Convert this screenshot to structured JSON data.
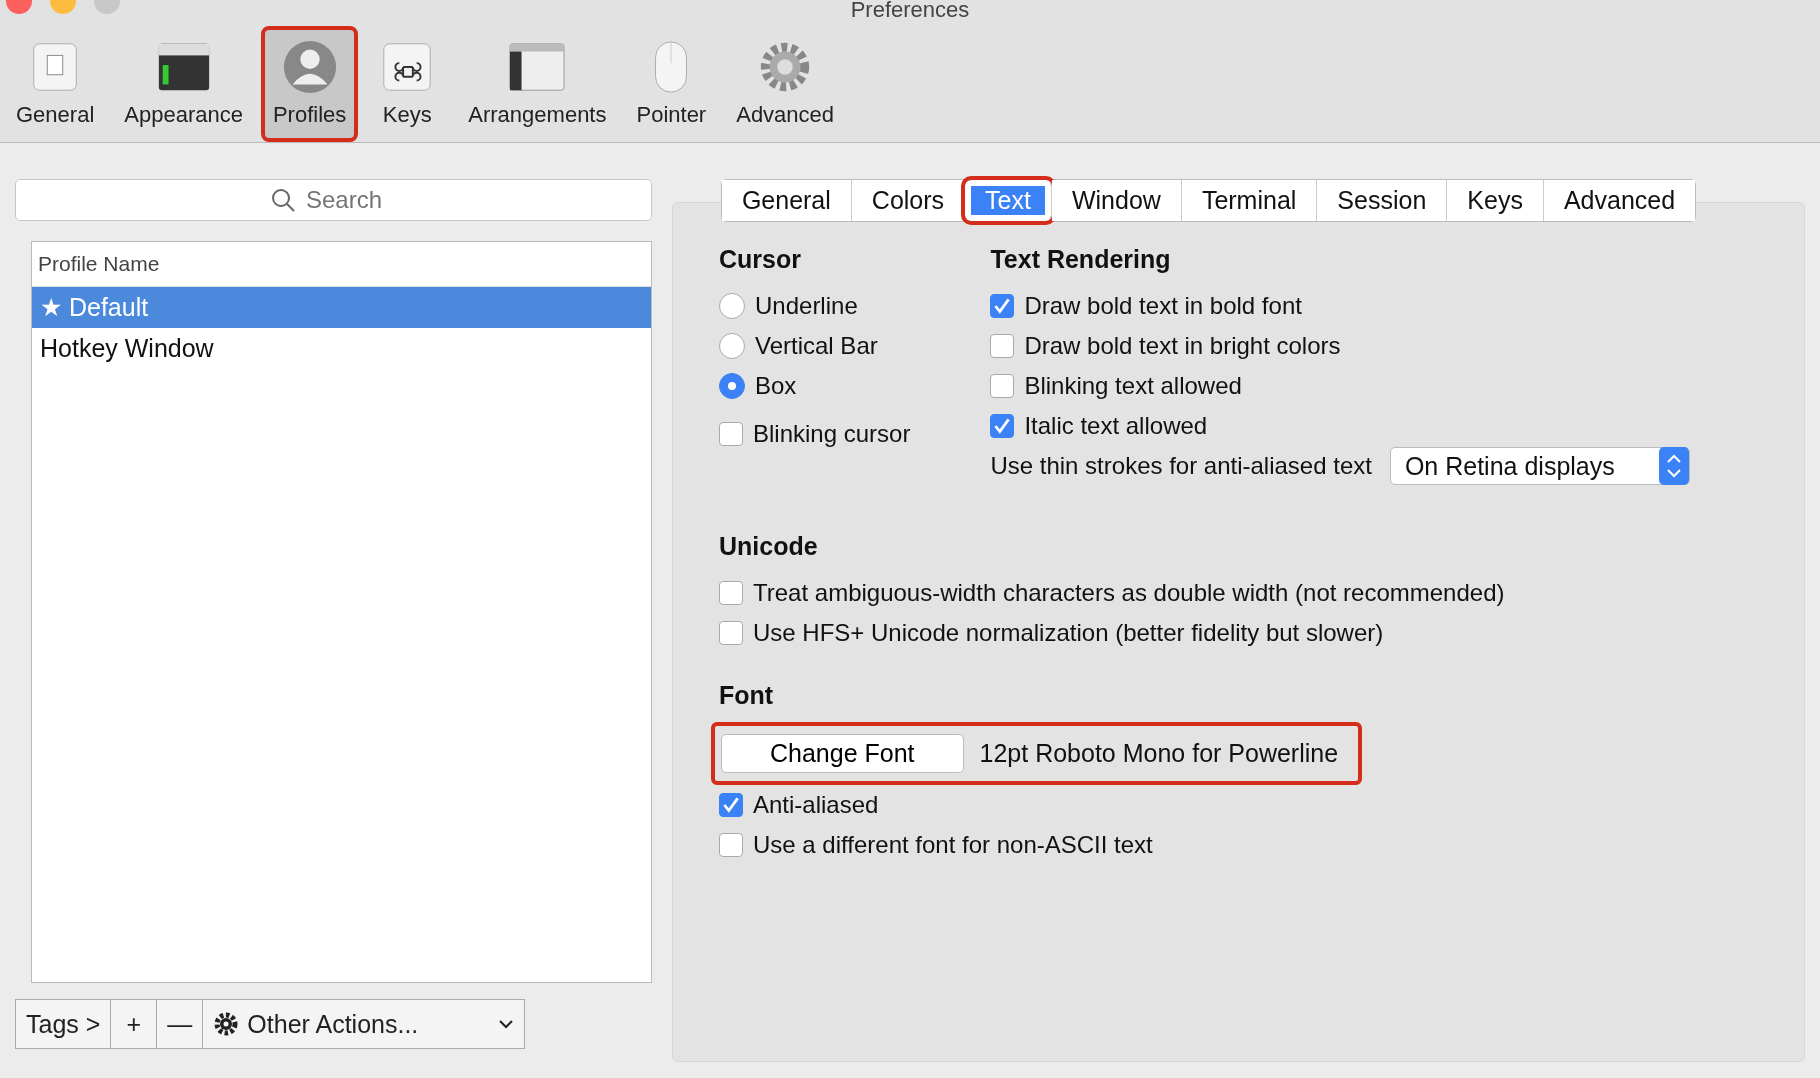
{
  "window": {
    "title": "Preferences"
  },
  "toolbar": [
    {
      "kind": "general",
      "label": "General",
      "selected": false,
      "highlighted": false
    },
    {
      "kind": "appearance",
      "label": "Appearance",
      "selected": false,
      "highlighted": false
    },
    {
      "kind": "profiles",
      "label": "Profiles",
      "selected": true,
      "highlighted": true
    },
    {
      "kind": "keys",
      "label": "Keys",
      "selected": false,
      "highlighted": false
    },
    {
      "kind": "arrangements",
      "label": "Arrangements",
      "selected": false,
      "highlighted": false
    },
    {
      "kind": "pointer",
      "label": "Pointer",
      "selected": false,
      "highlighted": false
    },
    {
      "kind": "advanced",
      "label": "Advanced",
      "selected": false,
      "highlighted": false
    }
  ],
  "search": {
    "placeholder": "Search"
  },
  "profiles": {
    "column": "Profile Name",
    "rows": [
      {
        "name": "★ Default",
        "selected": true
      },
      {
        "name": "Hotkey Window",
        "selected": false
      }
    ]
  },
  "bottom_bar": {
    "tags": "Tags >",
    "add": "+",
    "remove": "—",
    "actions": "Other Actions..."
  },
  "tabs": [
    {
      "label": "General",
      "selected": false,
      "highlighted": false
    },
    {
      "label": "Colors",
      "selected": false,
      "highlighted": false
    },
    {
      "label": "Text",
      "selected": true,
      "highlighted": true
    },
    {
      "label": "Window",
      "selected": false,
      "highlighted": false
    },
    {
      "label": "Terminal",
      "selected": false,
      "highlighted": false
    },
    {
      "label": "Session",
      "selected": false,
      "highlighted": false
    },
    {
      "label": "Keys",
      "selected": false,
      "highlighted": false
    },
    {
      "label": "Advanced",
      "selected": false,
      "highlighted": false
    }
  ],
  "cursor": {
    "title": "Cursor",
    "options": [
      {
        "label": "Underline",
        "selected": false
      },
      {
        "label": "Vertical Bar",
        "selected": false
      },
      {
        "label": "Box",
        "selected": true
      }
    ],
    "blinking": {
      "label": "Blinking cursor",
      "checked": false
    }
  },
  "text_rendering": {
    "title": "Text Rendering",
    "options": [
      {
        "label": "Draw bold text in bold font",
        "checked": true
      },
      {
        "label": "Draw bold text in bright colors",
        "checked": false
      },
      {
        "label": "Blinking text allowed",
        "checked": false
      },
      {
        "label": "Italic text allowed",
        "checked": true
      }
    ],
    "thin_strokes": {
      "label": "Use thin strokes for anti-aliased text",
      "value": "On Retina displays"
    }
  },
  "unicode": {
    "title": "Unicode",
    "options": [
      {
        "label": "Treat ambiguous-width characters as double width (not recommended)",
        "checked": false
      },
      {
        "label": "Use HFS+ Unicode normalization (better fidelity but slower)",
        "checked": false
      }
    ]
  },
  "font": {
    "title": "Font",
    "button": "Change Font",
    "value": "12pt Roboto Mono for Powerline",
    "highlighted": true,
    "options": [
      {
        "label": "Anti-aliased",
        "checked": true
      },
      {
        "label": "Use a different font for non-ASCII text",
        "checked": false
      }
    ]
  }
}
